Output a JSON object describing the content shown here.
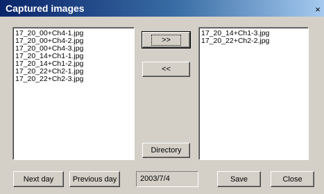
{
  "window": {
    "title": "Captured images",
    "close_glyph": "×"
  },
  "left_list": {
    "items": [
      "17_20_00+Ch4-1.jpg",
      "17_20_00+Ch4-2.jpg",
      "17_20_00+Ch4-3.jpg",
      "17_20_14+Ch1-1.jpg",
      "17_20_14+Ch1-2.jpg",
      "17_20_22+Ch2-1.jpg",
      "17_20_22+Ch2-3.jpg"
    ]
  },
  "right_list": {
    "items": [
      "17_20_14+Ch1-3.jpg",
      "17_20_22+Ch2-2.jpg"
    ]
  },
  "buttons": {
    "move_right": ">>",
    "move_left": "<<",
    "directory": "Directory",
    "next_day": "Next day",
    "previous_day": "Previous day",
    "save": "Save",
    "close": "Close"
  },
  "date": {
    "value": "2003/7/4"
  }
}
